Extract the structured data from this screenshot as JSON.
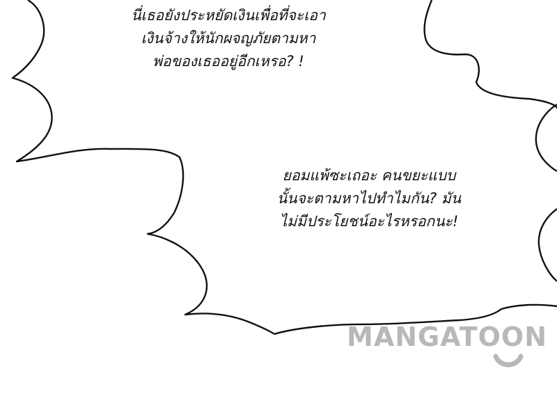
{
  "panel": {
    "speech_top": {
      "lines": [
        "นี่เธอยังประหยัดเงินเพื่อที่จะเอา",
        "เงินจ้างให้นักผจญภัยตามหา",
        "พ่อของเธออยู่อีกเหรอ? !"
      ]
    },
    "speech_middle": {
      "lines": [
        "ยอมแพ้ซะเถอะ คนขยะแบบ",
        "นั้นจะตามหาไปทำไมกัน? มัน",
        "ไม่มีประโยชน์อะไรหรอกนะ!"
      ]
    },
    "watermark": {
      "text": "MANGATOON",
      "color": "#b8b8b8"
    },
    "colors": {
      "ink": "#111111",
      "paper": "#ffffff"
    }
  }
}
